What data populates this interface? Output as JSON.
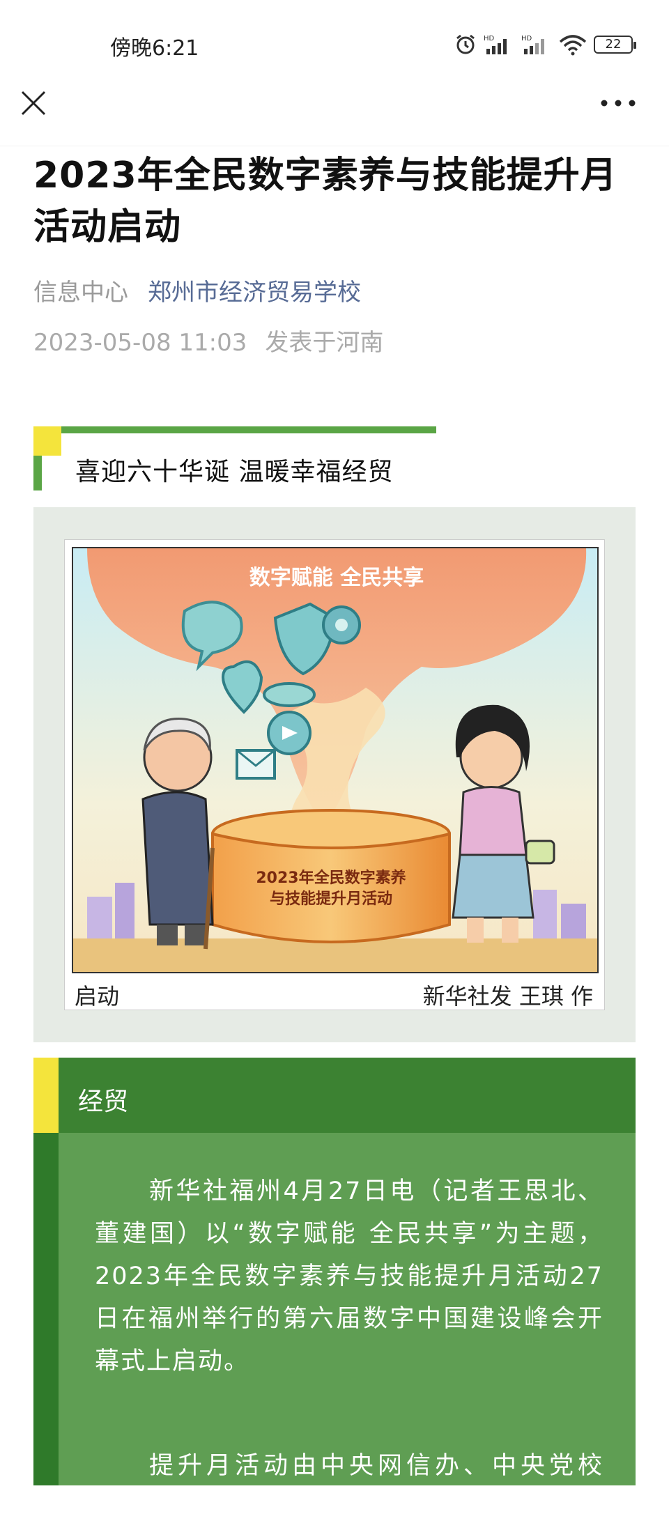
{
  "status_bar": {
    "time": "傍晚6:21",
    "battery": "22",
    "icons": [
      "alarm-icon",
      "hd-signal-icon",
      "hd-signal-icon",
      "wifi-icon",
      "battery-icon"
    ]
  },
  "nav": {
    "close_icon": "close-icon",
    "more_icon": "more-icon"
  },
  "article": {
    "title": "2023年全民数字素养与技能提升月活动启动",
    "author": "信息中心",
    "account": "郑州市经济贸易学校",
    "date": "2023-05-08 11:03",
    "location": "发表于河南"
  },
  "section": {
    "heading": "喜迎六十华诞  温暖幸福经贸"
  },
  "picture": {
    "banner": "数字赋能 全民共享",
    "podium": [
      "2023年全民数字素养",
      "与技能提升月活动"
    ],
    "caption_left": "启动",
    "caption_right": "新华社发  王琪 作"
  },
  "green_block": {
    "label": "经贸",
    "paragraphs": [
      "新华社福州4月27日电（记者王思北、董建国）以“数字赋能 全民共享”为主题，2023年全民数字素养与技能提升月活动27日在福州举行的第六届数字中国建设峰会开幕式上启动。",
      "提升月活动由中央网信办、中央党校（国家行政学院）、教育部、科技部、工"
    ]
  },
  "colors": {
    "accent_green": "#5aa545",
    "dark_green": "#2f7a2a",
    "accent_yellow": "#f4e43c",
    "account_blue": "#576b95"
  }
}
